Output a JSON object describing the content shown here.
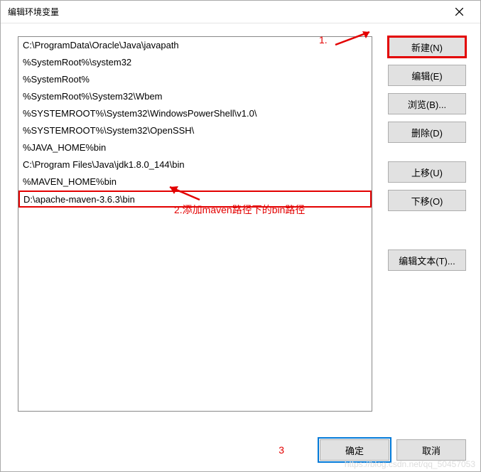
{
  "window": {
    "title": "编辑环境变量"
  },
  "list": {
    "items": [
      "C:\\ProgramData\\Oracle\\Java\\javapath",
      "%SystemRoot%\\system32",
      "%SystemRoot%",
      "%SystemRoot%\\System32\\Wbem",
      "%SYSTEMROOT%\\System32\\WindowsPowerShell\\v1.0\\",
      "%SYSTEMROOT%\\System32\\OpenSSH\\",
      "%JAVA_HOME%bin",
      "C:\\Program Files\\Java\\jdk1.8.0_144\\bin",
      "%MAVEN_HOME%bin",
      "D:\\apache-maven-3.6.3\\bin"
    ]
  },
  "buttons": {
    "new": "新建(N)",
    "edit": "编辑(E)",
    "browse": "浏览(B)...",
    "delete": "删除(D)",
    "move_up": "上移(U)",
    "move_down": "下移(O)",
    "edit_text": "编辑文本(T)...",
    "ok": "确定",
    "cancel": "取消"
  },
  "annotations": {
    "step1": "1.",
    "step2": "2.添加maven路径下的bin路径",
    "step3": "3"
  },
  "watermark": "https://blog.csdn.net/qq_50457053"
}
